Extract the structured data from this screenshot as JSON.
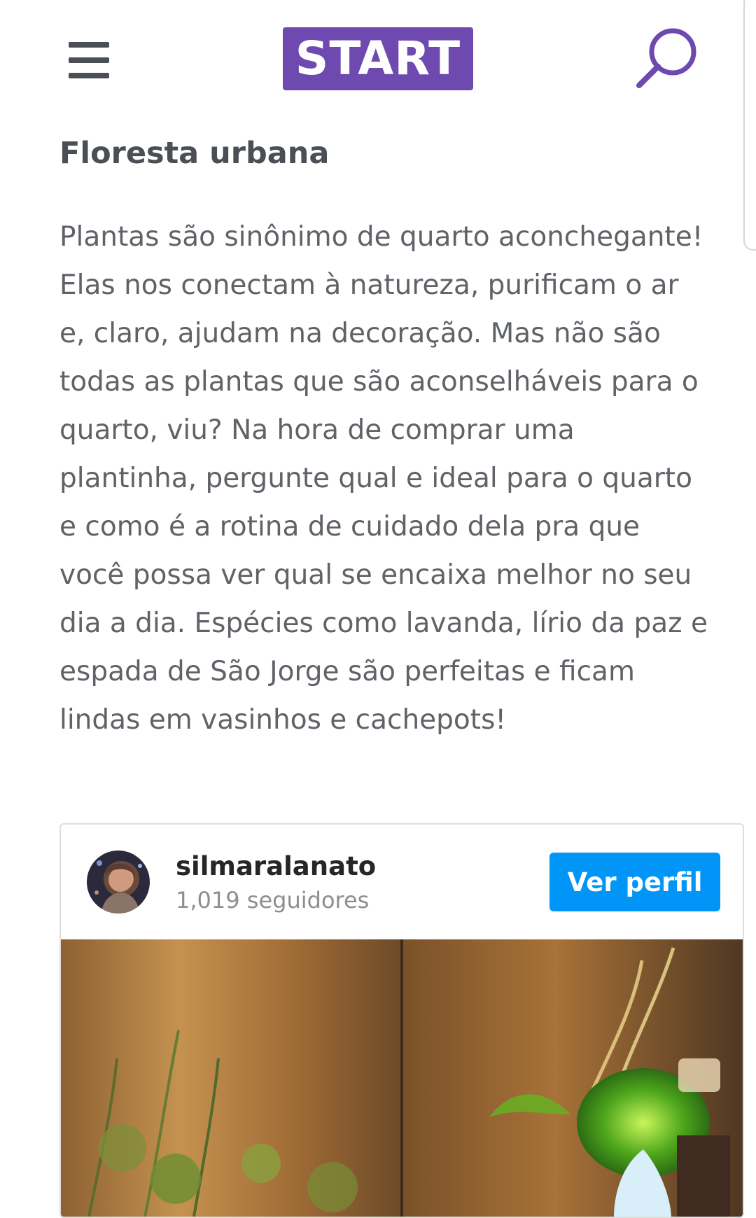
{
  "header": {
    "logo_text": "START",
    "brand_color": "#6e49b0",
    "menu_icon": "hamburger-menu-icon",
    "search_icon": "search-icon"
  },
  "article": {
    "title": "Floresta urbana",
    "paragraph": "Plantas são sinônimo de quarto aconchegante! Elas nos conectam à natureza, purificam o ar e, claro, ajudam na decoração. Mas não são todas as plantas que são aconselháveis para o quarto, viu? Na hora de comprar uma plantinha, pergunte qual e ideal para o quarto e como é a rotina de cuidado dela pra que você possa ver qual se encaixa melhor no seu dia a dia. Espécies como lavanda, lírio da paz e espada de São Jorge são perfeitas e ficam lindas em vasinhos e cachepots!"
  },
  "embed": {
    "username": "silmaralanato",
    "followers": "1,019 seguidores",
    "profile_button": "Ver perfil",
    "button_color": "#0095f6"
  }
}
